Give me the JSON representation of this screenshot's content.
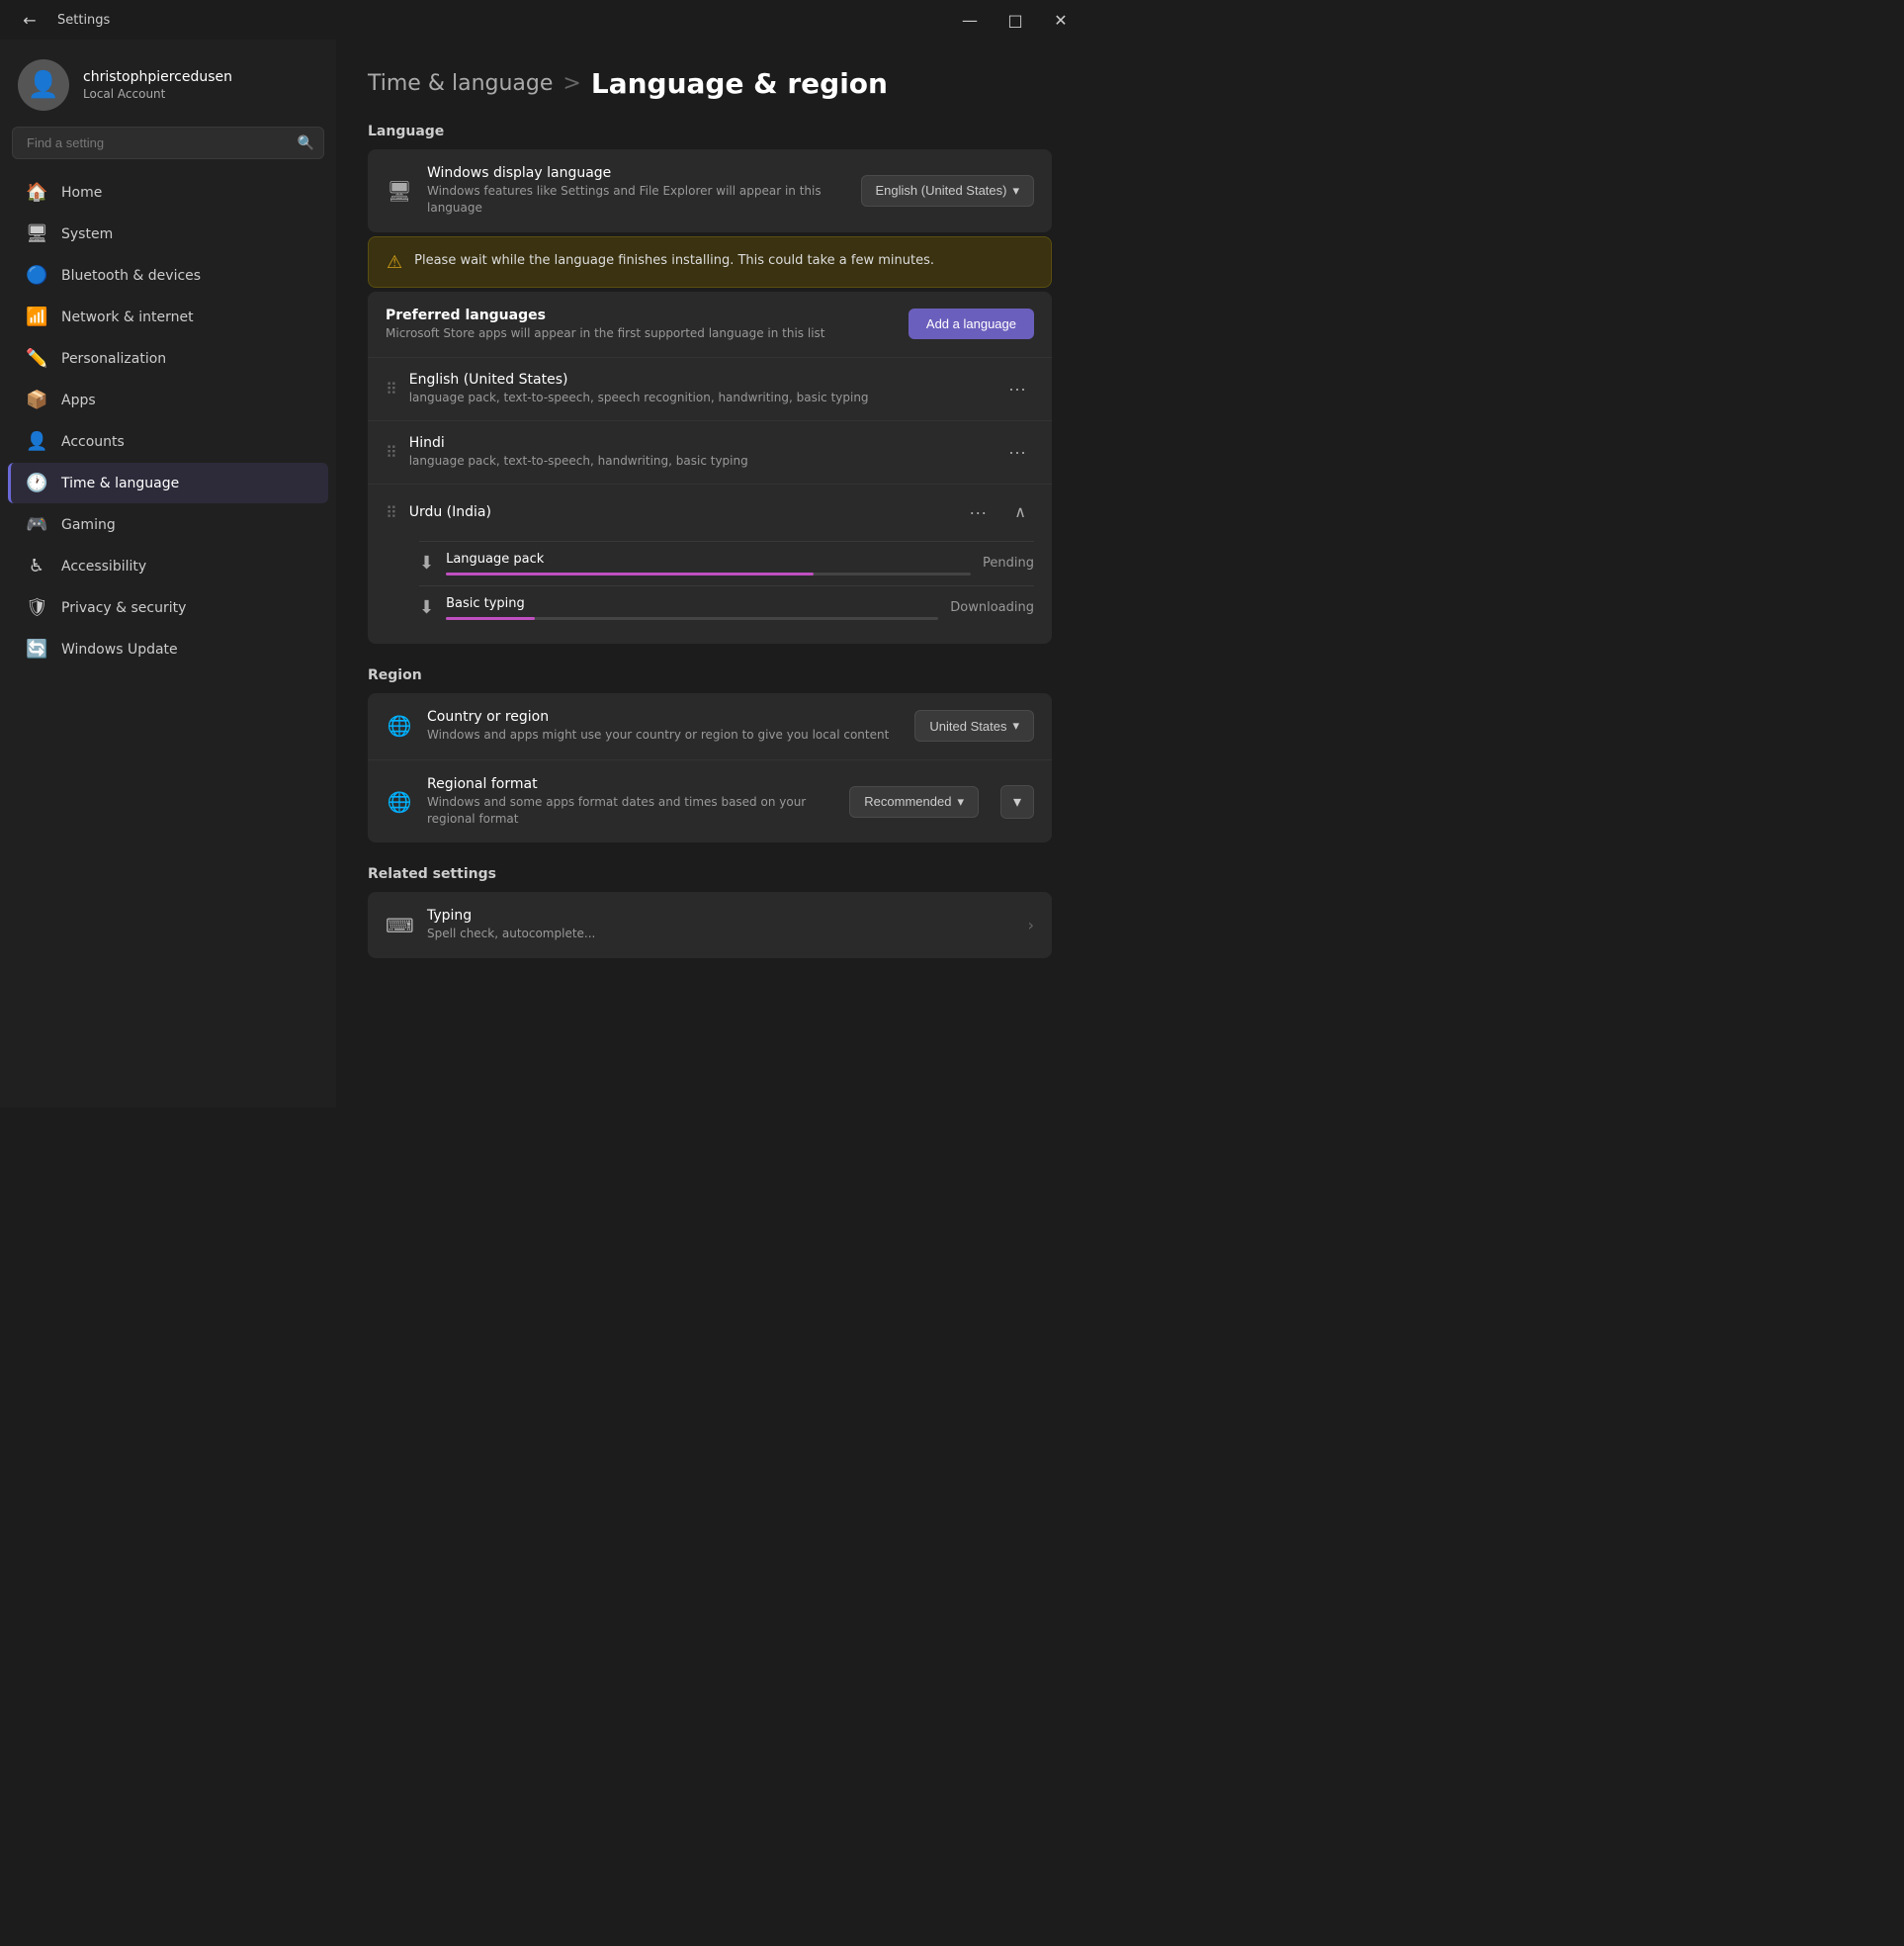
{
  "titlebar": {
    "title": "Settings",
    "back_icon": "←",
    "minimize": "—",
    "maximize": "□",
    "close": "✕"
  },
  "user": {
    "name": "christophpiercedusen",
    "role": "Local Account",
    "avatar_icon": "👤"
  },
  "search": {
    "placeholder": "Find a setting",
    "icon": "🔍"
  },
  "nav": [
    {
      "id": "home",
      "label": "Home",
      "icon": "🏠"
    },
    {
      "id": "system",
      "label": "System",
      "icon": "🖥"
    },
    {
      "id": "bluetooth",
      "label": "Bluetooth & devices",
      "icon": "🔵"
    },
    {
      "id": "network",
      "label": "Network & internet",
      "icon": "📶"
    },
    {
      "id": "personalization",
      "label": "Personalization",
      "icon": "✏️"
    },
    {
      "id": "apps",
      "label": "Apps",
      "icon": "📦"
    },
    {
      "id": "accounts",
      "label": "Accounts",
      "icon": "👤"
    },
    {
      "id": "time-language",
      "label": "Time & language",
      "icon": "🕐"
    },
    {
      "id": "gaming",
      "label": "Gaming",
      "icon": "🎮"
    },
    {
      "id": "accessibility",
      "label": "Accessibility",
      "icon": "♿"
    },
    {
      "id": "privacy-security",
      "label": "Privacy & security",
      "icon": "🛡"
    },
    {
      "id": "windows-update",
      "label": "Windows Update",
      "icon": "🔄"
    }
  ],
  "active_nav": "time-language",
  "breadcrumb": {
    "parent": "Time & language",
    "separator": ">",
    "current": "Language & region"
  },
  "language_section": {
    "label": "Language",
    "windows_display": {
      "title": "Windows display language",
      "subtitle": "Windows features like Settings and File Explorer will appear in this language",
      "value": "English (United States)",
      "icon": "🖥"
    },
    "warning": "Please wait while the language finishes installing. This could take a few minutes.",
    "preferred": {
      "title": "Preferred languages",
      "subtitle": "Microsoft Store apps will appear in the first supported language in this list",
      "add_button": "Add a language"
    },
    "languages": [
      {
        "id": "en-us",
        "name": "English (United States)",
        "detail": "language pack, text-to-speech, speech recognition, handwriting, basic typing",
        "expanded": false
      },
      {
        "id": "hi",
        "name": "Hindi",
        "detail": "language pack, text-to-speech, handwriting, basic typing",
        "expanded": false
      },
      {
        "id": "ur-in",
        "name": "Urdu (India)",
        "detail": "",
        "expanded": true,
        "downloads": [
          {
            "name": "Language pack",
            "status": "Pending",
            "progress": 70
          },
          {
            "name": "Basic typing",
            "status": "Downloading",
            "progress": 18
          }
        ]
      }
    ]
  },
  "region_section": {
    "label": "Region",
    "country": {
      "title": "Country or region",
      "subtitle": "Windows and apps might use your country or region to give you local content",
      "value": "United States",
      "icon": "🌐"
    },
    "format": {
      "title": "Regional format",
      "subtitle": "Windows and some apps format dates and times based on your regional format",
      "value": "Recommended",
      "icon": "🌐"
    }
  },
  "related_section": {
    "label": "Related settings",
    "items": [
      {
        "title": "Typing",
        "subtitle": "Spell check, autocomplete...",
        "icon": "⌨"
      }
    ]
  }
}
